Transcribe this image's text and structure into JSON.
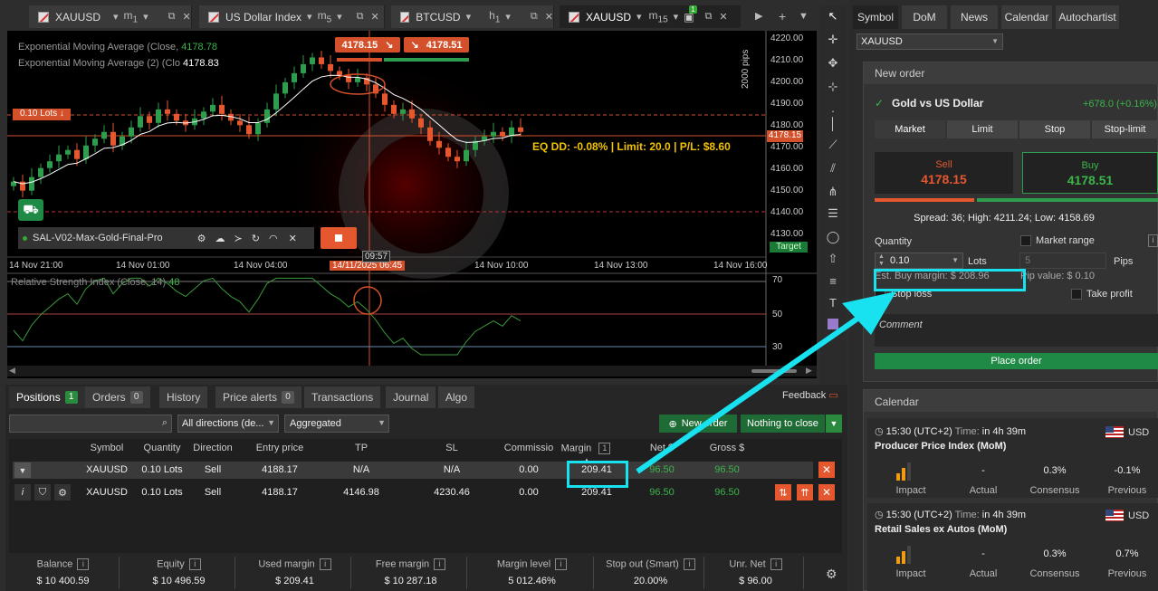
{
  "tabs": [
    {
      "symbol": "XAUUSD",
      "tf": "m",
      "tfsub": "1"
    },
    {
      "symbol": "US Dollar Index",
      "tf": "m",
      "tfsub": "5"
    },
    {
      "symbol": "BTCUSD",
      "tf": "h",
      "tfsub": "1"
    },
    {
      "symbol": "XAUUSD",
      "tf": "m",
      "tfsub": "15",
      "badge": "1"
    }
  ],
  "chart": {
    "ema1_label": "Exponential Moving Average (Close,",
    "ema1_value": "4178.78",
    "ema2_label": "Exponential Moving Average (2) (Clo",
    "ema2_value": "4178.83",
    "sell_quote": "4178.15",
    "buy_quote": "4178.51",
    "lots_tag": "0.10 Lots",
    "pips_label": "2000 pips",
    "price_ticks": [
      "4220.00",
      "4210.00",
      "4200.00",
      "4190.00",
      "4180.00",
      "4170.00",
      "4160.00",
      "4150.00",
      "4140.00",
      "4130.00"
    ],
    "current_price": "4178.15",
    "target_label": "Target",
    "eq_text": "EQ DD: -0.08% | Limit: 20.0 | P/L: $8.60",
    "time_ticks": [
      "14 Nov 21:00",
      "14 Nov 01:00",
      "14 Nov 04:00",
      "14/11/2025 06:45",
      "14 Nov 10:00",
      "14 Nov 13:00",
      "14 Nov 16:00"
    ],
    "cursor_time": "09:57",
    "algo_name": "SAL-V02-Max-Gold-Final-Pro",
    "rsi_label": "Relative Strength Index (Close, 14)",
    "rsi_value": "48",
    "rsi_ticks": [
      "70",
      "50",
      "30"
    ],
    "colors": {
      "up": "#2e9e4e",
      "down": "#e5572f",
      "ema": "#ffffff",
      "rsi": "#3a9a3a"
    }
  },
  "bottom": {
    "tabs": [
      {
        "label": "Positions",
        "badge": "1"
      },
      {
        "label": "Orders",
        "badge": "0"
      },
      {
        "label": "History"
      },
      {
        "label": "Price alerts",
        "badge": "0"
      },
      {
        "label": "Transactions"
      },
      {
        "label": "Journal"
      },
      {
        "label": "Algo"
      }
    ],
    "feedback": "Feedback",
    "direction_filter": "All directions (de...",
    "grouping": "Aggregated",
    "new_order": "New order",
    "nothing_to_close": "Nothing to close",
    "columns": [
      "Symbol",
      "Quantity",
      "Direction",
      "Entry price",
      "TP",
      "SL",
      "Commissio",
      "Margin",
      "Net $",
      "Gross $"
    ],
    "margin_badge": "1",
    "rows": [
      {
        "symbol": "XAUUSD",
        "qty": "0.10 Lots",
        "dir": "Sell",
        "entry": "4188.17",
        "tp": "N/A",
        "sl": "N/A",
        "comm": "0.00",
        "margin": "209.41",
        "net": "96.50",
        "gross": "96.50"
      },
      {
        "symbol": "XAUUSD",
        "qty": "0.10 Lots",
        "dir": "Sell",
        "entry": "4188.17",
        "tp": "4146.98",
        "sl": "4230.46",
        "comm": "0.00",
        "margin": "209.41",
        "net": "96.50",
        "gross": "96.50"
      }
    ],
    "status": [
      {
        "label": "Balance",
        "value": "$ 10 400.59"
      },
      {
        "label": "Equity",
        "value": "$ 10 496.59"
      },
      {
        "label": "Used margin",
        "value": "$ 209.41"
      },
      {
        "label": "Free margin",
        "value": "$ 10 287.18"
      },
      {
        "label": "Margin level",
        "value": "5 012.46%"
      },
      {
        "label": "Stop out (Smart)",
        "value": "20.00%"
      },
      {
        "label": "Unr. Net",
        "value": "$ 96.00"
      }
    ]
  },
  "right": {
    "tabs": [
      "Symbol",
      "DoM",
      "News",
      "Calendar",
      "Autochartist"
    ],
    "symbol": "XAUUSD",
    "new_order_title": "New order",
    "instrument": "Gold vs US Dollar",
    "change": "+678.0 (+0.16%)",
    "order_types": [
      "Market",
      "Limit",
      "Stop",
      "Stop-limit"
    ],
    "sell_label": "Sell",
    "sell_price": "4178.15",
    "buy_label": "Buy",
    "buy_price": "4178.51",
    "spread": "Spread: 36; High: 4211.24; Low: 4158.69",
    "quantity_label": "Quantity",
    "market_range": "Market range",
    "qty_value": "0.10",
    "lots": "Lots",
    "pips_value": "5",
    "pips": "Pips",
    "est_margin": "Est. Buy margin: $ 208.96",
    "pip_value": "Pip value: $ 0.10",
    "stop_loss": "Stop loss",
    "take_profit": "Take profit",
    "comment_placeholder": "Comment",
    "place_order": "Place order",
    "calendar_title": "Calendar",
    "events": [
      {
        "time": "15:30",
        "tz": "(UTC+2)",
        "time_label": "Time:",
        "remaining": "in 4h 39m",
        "currency": "USD",
        "name": "Producer Price Index (MoM)",
        "actual": "-",
        "consensus": "0.3%",
        "previous": "-0.1%"
      },
      {
        "time": "15:30",
        "tz": "(UTC+2)",
        "time_label": "Time:",
        "remaining": "in 4h 39m",
        "currency": "USD",
        "name": "Retail Sales ex Autos (MoM)",
        "actual": "-",
        "consensus": "0.3%",
        "previous": "0.7%"
      }
    ],
    "stat_labels": [
      "Impact",
      "Actual",
      "Consensus",
      "Previous"
    ]
  }
}
